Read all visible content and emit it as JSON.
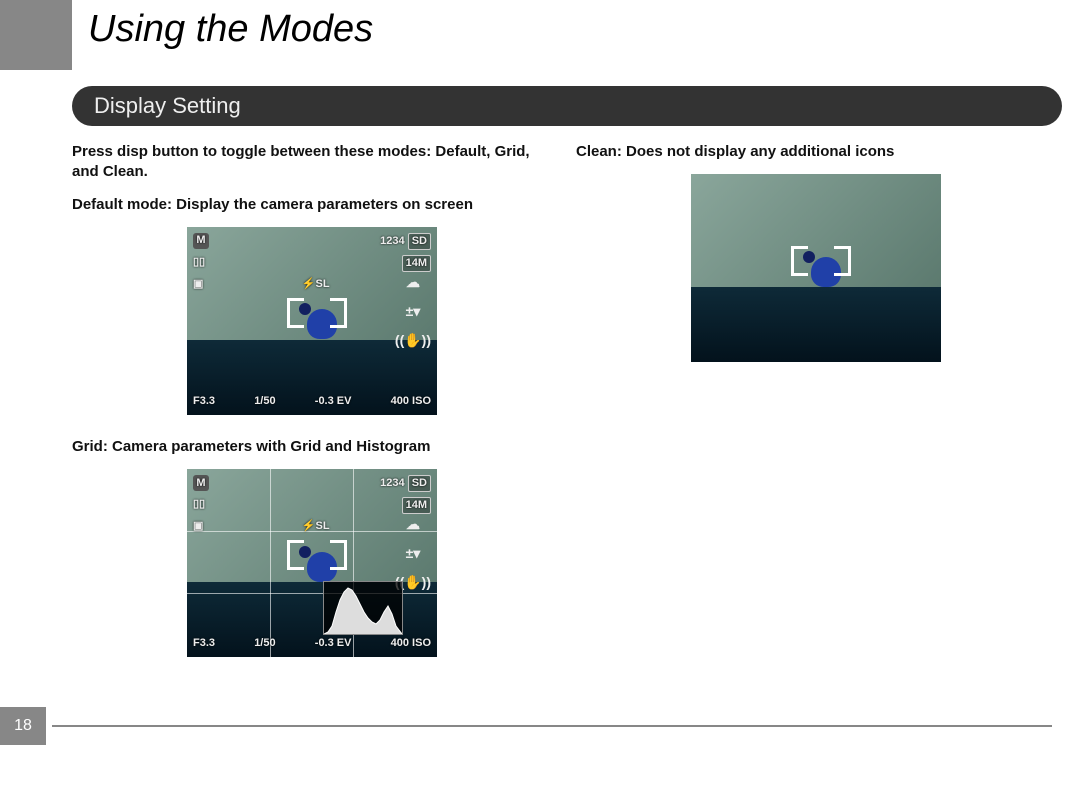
{
  "page_title": "Using the Modes",
  "section_title": "Display Setting",
  "page_number": "18",
  "left": {
    "para1_pre": "Press ",
    "para1_bold": "disp",
    "para1_post": " button to toggle between these modes: Default, Grid, and Clean.",
    "para2": "Default mode: Display the camera parameters on screen",
    "para3": "Grid: Camera parameters with Grid and Histogram"
  },
  "right": {
    "para1": "Clean: Does not display any additional icons"
  },
  "camera_overlay": {
    "mode_letter": "M",
    "counter": "1234",
    "card": "SD",
    "size": "14M",
    "aperture": "F3.3",
    "shutter": "1/50",
    "exposure": "-0.3 EV",
    "iso": "400 ISO"
  }
}
